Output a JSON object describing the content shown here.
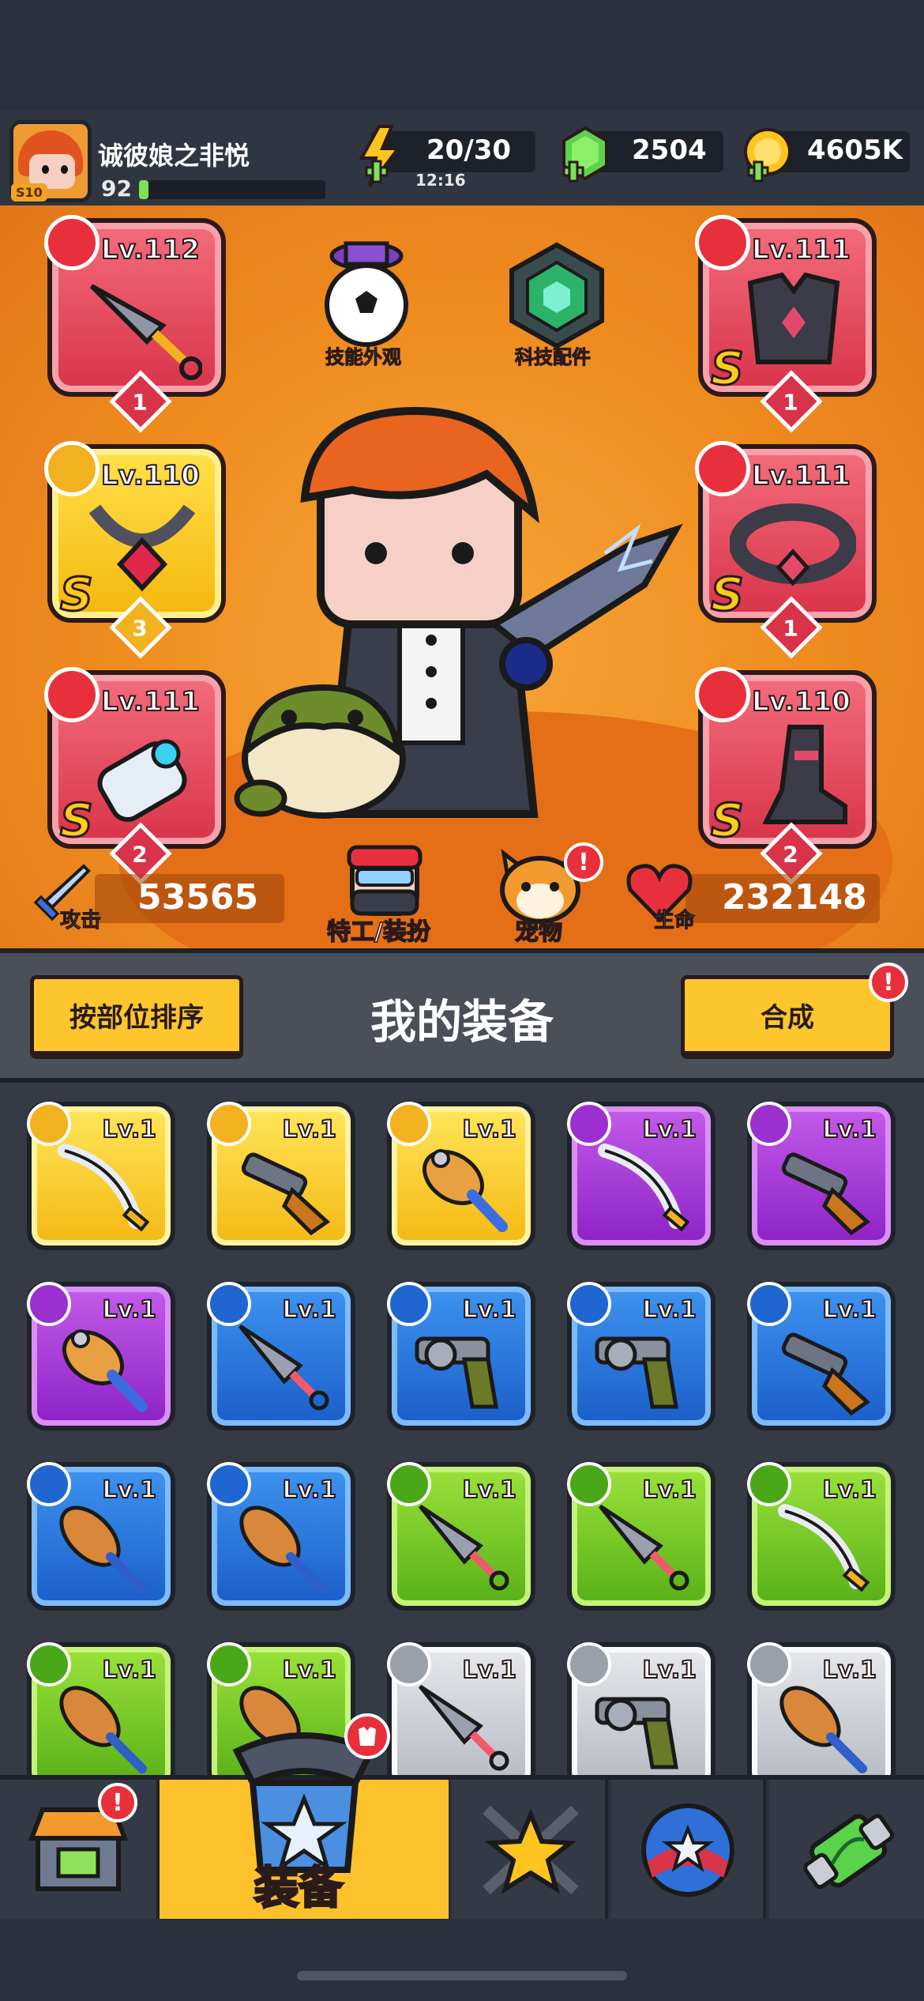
{
  "player": {
    "name": "诚彼娘之非悦",
    "level": "92",
    "vip_badge": "S10",
    "xp_fraction": 0.05
  },
  "resources": {
    "energy": "20/30",
    "energy_timer": "12:16",
    "gems": "2504",
    "gold": "4605K"
  },
  "hero": {
    "skin_label": "技能外观",
    "tech_label": "科技配件",
    "agent_label": "特工/装扮",
    "pet_label": "宠物",
    "attack_label": "攻击",
    "attack_value": "53565",
    "hp_label": "生命",
    "hp_value": "232148",
    "pet_alert": "!"
  },
  "equipped": [
    {
      "slot": "weapon",
      "level": "Lv.112",
      "count": "1",
      "rank": "",
      "color": "red",
      "icon": "kunai-icon"
    },
    {
      "slot": "armor",
      "level": "Lv.111",
      "count": "1",
      "rank": "S",
      "color": "red",
      "icon": "armor-icon"
    },
    {
      "slot": "necklace",
      "level": "Lv.110",
      "count": "3",
      "rank": "S",
      "color": "yellow",
      "icon": "necklace-icon"
    },
    {
      "slot": "belt",
      "level": "Lv.111",
      "count": "1",
      "rank": "S",
      "color": "red",
      "icon": "belt-icon"
    },
    {
      "slot": "gloves",
      "level": "Lv.111",
      "count": "2",
      "rank": "S",
      "color": "red",
      "icon": "gauntlet-icon"
    },
    {
      "slot": "boots",
      "level": "Lv.110",
      "count": "2",
      "rank": "S",
      "color": "red",
      "icon": "boots-icon"
    }
  ],
  "section": {
    "sort_label": "按部位排序",
    "title": "我的装备",
    "merge_label": "合成",
    "merge_alert": "!"
  },
  "inventory": [
    {
      "level": "Lv.1",
      "tier": "yellow",
      "icon": "sword-icon"
    },
    {
      "level": "Lv.1",
      "tier": "yellow",
      "icon": "shotgun-icon"
    },
    {
      "level": "Lv.1",
      "tier": "yellow",
      "icon": "club-icon"
    },
    {
      "level": "Lv.1",
      "tier": "purple",
      "icon": "sword-icon"
    },
    {
      "level": "Lv.1",
      "tier": "purple",
      "icon": "shotgun-icon"
    },
    {
      "level": "Lv.1",
      "tier": "purple",
      "icon": "club-icon"
    },
    {
      "level": "Lv.1",
      "tier": "blue",
      "icon": "kunai-icon"
    },
    {
      "level": "Lv.1",
      "tier": "blue",
      "icon": "revolver-icon"
    },
    {
      "level": "Lv.1",
      "tier": "blue",
      "icon": "revolver-icon"
    },
    {
      "level": "Lv.1",
      "tier": "blue",
      "icon": "shotgun-icon"
    },
    {
      "level": "Lv.1",
      "tier": "blue",
      "icon": "bat-icon"
    },
    {
      "level": "Lv.1",
      "tier": "blue",
      "icon": "bat-icon"
    },
    {
      "level": "Lv.1",
      "tier": "green",
      "icon": "kunai-icon"
    },
    {
      "level": "Lv.1",
      "tier": "green",
      "icon": "kunai-icon"
    },
    {
      "level": "Lv.1",
      "tier": "green",
      "icon": "sword-icon"
    },
    {
      "level": "Lv.1",
      "tier": "green",
      "icon": "bat-icon"
    },
    {
      "level": "Lv.1",
      "tier": "green",
      "icon": "bat-icon"
    },
    {
      "level": "Lv.1",
      "tier": "gray",
      "icon": "kunai-icon"
    },
    {
      "level": "Lv.1",
      "tier": "gray",
      "icon": "revolver-icon"
    },
    {
      "level": "Lv.1",
      "tier": "gray",
      "icon": "bat-icon"
    }
  ],
  "nav": {
    "shop_alert": "!",
    "equipment_label": "装备"
  },
  "colors": {
    "hero_orange": "#ef8b1f",
    "button_yellow": "#fdc62c",
    "alert_red": "#e8303d"
  }
}
